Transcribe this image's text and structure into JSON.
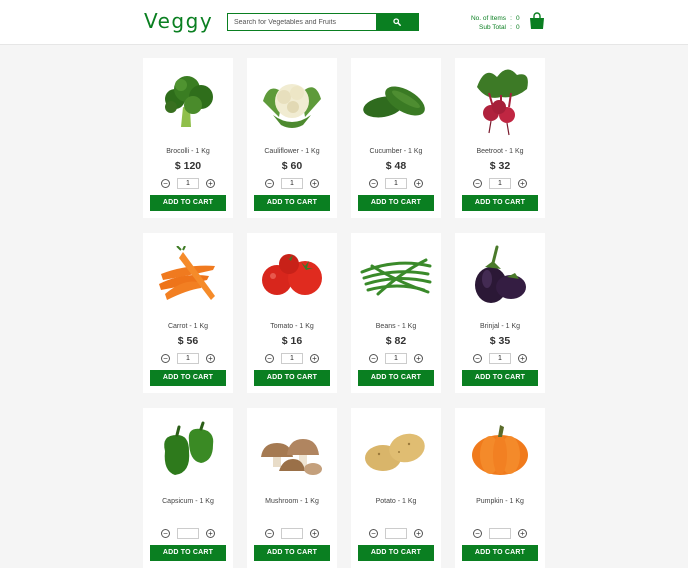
{
  "header": {
    "logo": "Veggy",
    "search_placeholder": "Search for Vegetables and Fruits",
    "items_label": "No. of Items",
    "items_value": "0",
    "subtotal_label": "Sub Total",
    "subtotal_value": "0",
    "separator": ":"
  },
  "add_label": "ADD TO CART",
  "products": [
    {
      "name": "Brocolli - 1 Kg",
      "price": "$ 120",
      "qty": "1",
      "icon": "broccoli-icon"
    },
    {
      "name": "Cauliflower - 1 Kg",
      "price": "$ 60",
      "qty": "1",
      "icon": "cauliflower-icon"
    },
    {
      "name": "Cucumber - 1 Kg",
      "price": "$ 48",
      "qty": "1",
      "icon": "cucumber-icon"
    },
    {
      "name": "Beetroot - 1 Kg",
      "price": "$ 32",
      "qty": "1",
      "icon": "beetroot-icon"
    },
    {
      "name": "Carrot - 1 Kg",
      "price": "$ 56",
      "qty": "1",
      "icon": "carrot-icon"
    },
    {
      "name": "Tomato - 1 Kg",
      "price": "$ 16",
      "qty": "1",
      "icon": "tomato-icon"
    },
    {
      "name": "Beans - 1 Kg",
      "price": "$ 82",
      "qty": "1",
      "icon": "beans-icon"
    },
    {
      "name": "Brinjal - 1 Kg",
      "price": "$ 35",
      "qty": "1",
      "icon": "brinjal-icon"
    },
    {
      "name": "Capsicum - 1 Kg",
      "price": "",
      "qty": "",
      "icon": "capsicum-icon"
    },
    {
      "name": "Mushroom - 1 Kg",
      "price": "",
      "qty": "",
      "icon": "mushroom-icon"
    },
    {
      "name": "Potato - 1 Kg",
      "price": "",
      "qty": "",
      "icon": "potato-icon"
    },
    {
      "name": "Pumpkin - 1 Kg",
      "price": "",
      "qty": "",
      "icon": "pumpkin-icon"
    }
  ],
  "colors": {
    "brand": "#0a7f21"
  }
}
